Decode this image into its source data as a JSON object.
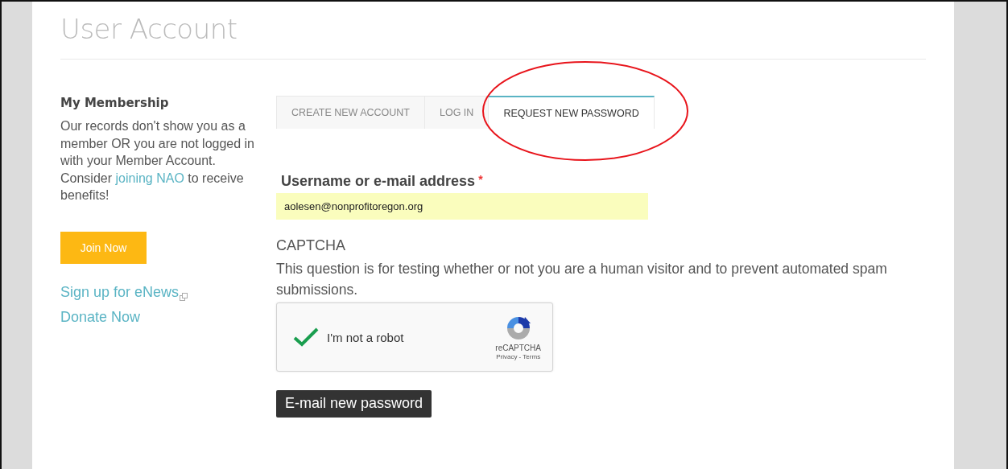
{
  "page": {
    "title": "User Account"
  },
  "sidebar": {
    "heading": "My Membership",
    "text_before": "Our records don't show you as a member OR you are not logged in with your Member Account. Consider ",
    "link": "joining NAO",
    "text_after": " to receive benefits!",
    "join_button": "Join Now",
    "links": [
      {
        "label": "Sign up for eNews",
        "external": true
      },
      {
        "label": "Donate Now",
        "external": false
      }
    ]
  },
  "tabs": [
    {
      "label": "CREATE NEW ACCOUNT",
      "selected": false
    },
    {
      "label": "LOG IN",
      "selected": false
    },
    {
      "label": "REQUEST NEW PASSWORD",
      "selected": true
    }
  ],
  "form": {
    "label": "Username or e-mail address",
    "required_mark": "*",
    "value": "aolesen@nonprofitoregon.org",
    "captcha_title": "CAPTCHA",
    "captcha_description": "This question is for testing whether or not you are a human visitor and to prevent automated spam submissions.",
    "recaptcha": {
      "label": "I'm not a robot",
      "checked": true,
      "brand": "reCAPTCHA",
      "privacy": "Privacy",
      "separator": " - ",
      "terms": "Terms"
    },
    "submit": "E-mail new password"
  },
  "annotation": {
    "color": "#e8141b"
  }
}
